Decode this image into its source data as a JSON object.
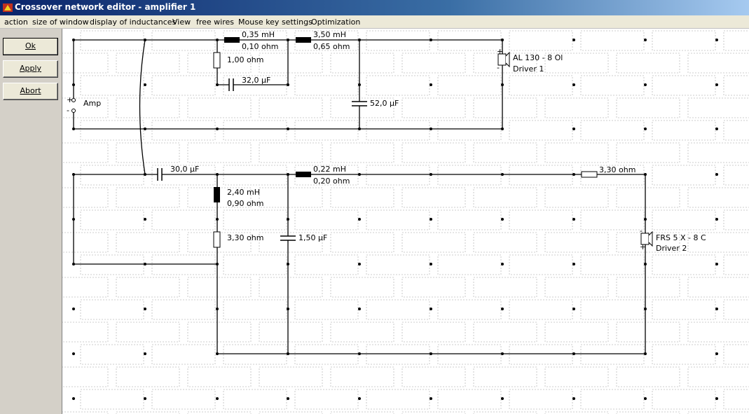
{
  "window": {
    "title": "Crossover network editor - amplifier 1"
  },
  "menu": [
    "action",
    "size of window",
    "display of inductances",
    "View",
    "free wires",
    "Mouse key settings",
    "Optimization"
  ],
  "buttons": {
    "ok": "Ok",
    "apply": "Apply",
    "abort": "Abort"
  },
  "schematic": {
    "amp": {
      "label": "Amp",
      "plus": "+",
      "minus": "-"
    },
    "components": [
      {
        "id": "l1",
        "type": "inductor",
        "value": "0,35 mH",
        "dcr": "0,10 ohm"
      },
      {
        "id": "r1",
        "type": "resistor",
        "value": "1,00 ohm"
      },
      {
        "id": "c1",
        "type": "capacitor",
        "value": "32,0 µF"
      },
      {
        "id": "l2",
        "type": "inductor",
        "value": "3,50 mH",
        "dcr": "0,65 ohm"
      },
      {
        "id": "c2",
        "type": "capacitor",
        "value": "52,0 µF"
      },
      {
        "id": "c3",
        "type": "capacitor",
        "value": "30,0 µF"
      },
      {
        "id": "l3",
        "type": "inductor",
        "value": "0,22 mH",
        "dcr": "0,20 ohm"
      },
      {
        "id": "r2",
        "type": "resistor",
        "value": "3,30 ohm"
      },
      {
        "id": "l4",
        "type": "inductor",
        "value": "2,40 mH",
        "dcr": "0,90 ohm"
      },
      {
        "id": "r3",
        "type": "resistor",
        "value": "3,30 ohm"
      },
      {
        "id": "c4",
        "type": "capacitor",
        "value": "1,50 µF"
      }
    ],
    "drivers": [
      {
        "id": "d1",
        "model": "AL 130 - 8 Ol",
        "name": "Driver 1",
        "plus": "+",
        "minus": "-"
      },
      {
        "id": "d2",
        "model": "FRS 5 X - 8 C",
        "name": "Driver 2",
        "plus": "+",
        "minus": "-"
      }
    ]
  }
}
